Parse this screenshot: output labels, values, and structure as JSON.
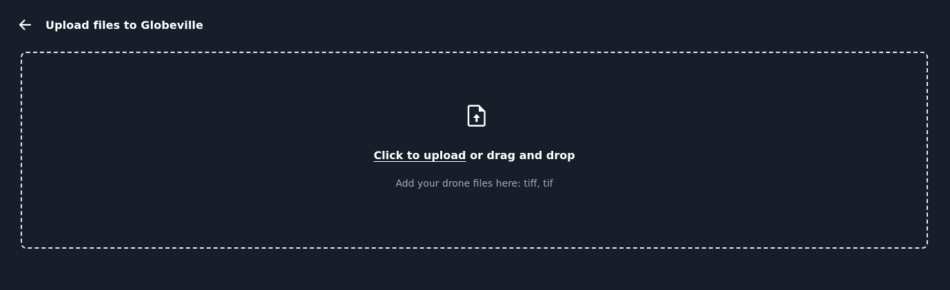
{
  "header": {
    "back_icon": "arrow-left-icon",
    "title": "Upload files to Globeville"
  },
  "dropzone": {
    "icon": "file-upload-icon",
    "click_text": "Click to upload",
    "drag_text": " or drag and drop",
    "hint": "Add your drone files here: tiff, tif"
  },
  "colors": {
    "background": "#171d29",
    "text_primary": "#ffffff",
    "text_secondary": "#a3a9b5",
    "dash_border": "#e6e8ec"
  }
}
